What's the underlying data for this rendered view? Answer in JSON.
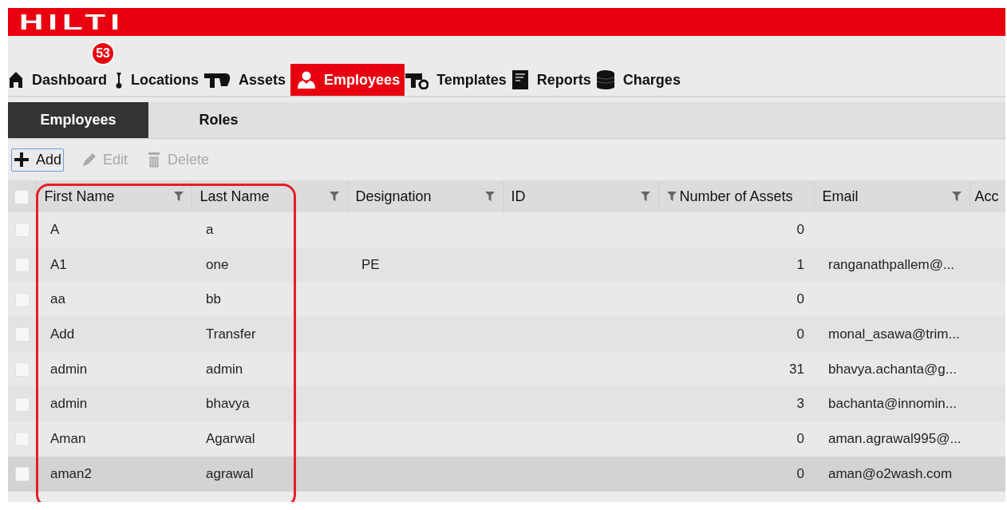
{
  "logo": "HILTI",
  "nav": [
    {
      "label": "Dashboard",
      "selected": false,
      "badge": "53"
    },
    {
      "label": "Locations",
      "selected": false
    },
    {
      "label": "Assets",
      "selected": false
    },
    {
      "label": "Employees",
      "selected": true
    },
    {
      "label": "Templates",
      "selected": false
    },
    {
      "label": "Reports",
      "selected": false
    },
    {
      "label": "Charges",
      "selected": false
    }
  ],
  "subtabs": [
    {
      "label": "Employees",
      "selected": true
    },
    {
      "label": "Roles",
      "selected": false
    }
  ],
  "toolbar": [
    {
      "label": "Add",
      "disabled": false,
      "focused": true
    },
    {
      "label": "Edit",
      "disabled": true,
      "focused": false
    },
    {
      "label": "Delete",
      "disabled": true,
      "focused": false
    }
  ],
  "table": {
    "select_all_checked": false,
    "columns": [
      "First Name",
      "Last Name",
      "Designation",
      "ID",
      "Number of Assets",
      "Email",
      "Acc"
    ],
    "rows": [
      {
        "selected": false,
        "checked": false,
        "cells": [
          "A",
          "a",
          "",
          "",
          "0",
          "",
          ""
        ]
      },
      {
        "selected": false,
        "checked": false,
        "cells": [
          "A1",
          "one",
          "PE",
          "",
          "1",
          "ranganathpallem@...",
          ""
        ]
      },
      {
        "selected": false,
        "checked": false,
        "cells": [
          "aa",
          "bb",
          "",
          "",
          "0",
          "",
          ""
        ]
      },
      {
        "selected": false,
        "checked": false,
        "cells": [
          "Add",
          "Transfer",
          "",
          "",
          "0",
          "monal_asawa@trim...",
          ""
        ]
      },
      {
        "selected": false,
        "checked": false,
        "cells": [
          "admin",
          "admin",
          "",
          "",
          "31",
          "bhavya.achanta@g...",
          ""
        ]
      },
      {
        "selected": false,
        "checked": false,
        "cells": [
          "admin",
          "bhavya",
          "",
          "",
          "3",
          "bachanta@innomin...",
          ""
        ]
      },
      {
        "selected": false,
        "checked": false,
        "cells": [
          "Aman",
          "Agarwal",
          "",
          "",
          "0",
          "aman.agrawal995@...",
          ""
        ]
      },
      {
        "selected": true,
        "checked": false,
        "cells": [
          "aman2",
          "agrawal",
          "",
          "",
          "0",
          "aman@o2wash.com",
          ""
        ]
      }
    ]
  }
}
